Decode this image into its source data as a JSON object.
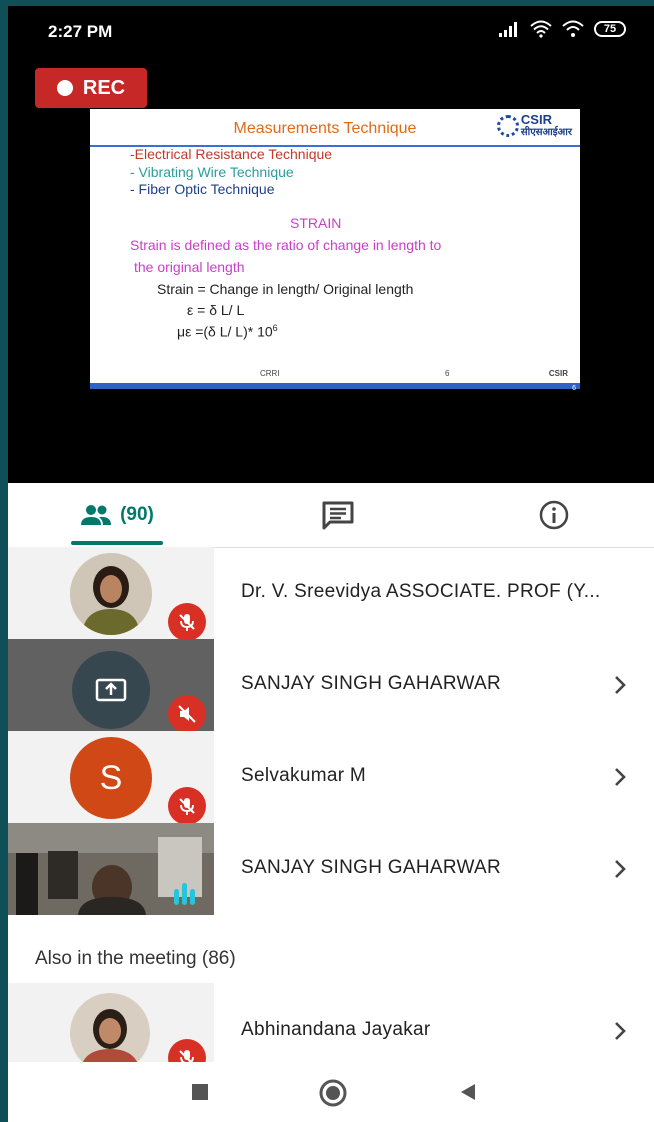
{
  "status_bar": {
    "time": "2:27 PM",
    "battery": "75"
  },
  "recording": {
    "label": "REC"
  },
  "slide": {
    "title": "Measurements Technique",
    "logo_text_top": "CSIR",
    "logo_text_bottom": "सीएसआईआर",
    "lines": [
      "-Electrical Resistance Technique",
      "- Vibrating Wire Technique",
      "- Fiber Optic Technique",
      "STRAIN",
      "Strain is defined as the ratio of change in length to",
      "the original length",
      "Strain = Change in length/ Original length",
      "ε = δ L/ L",
      "με =(δ L/ L)* 10",
      "6"
    ],
    "footer_left": "CRRI",
    "footer_mid": "6",
    "footer_right": "CSIR",
    "footer_page": "6"
  },
  "tabs": {
    "people_count": "(90)"
  },
  "participants": [
    {
      "name": "Dr. V. Sreevidya ASSOCIATE. PROF (Y..."
    },
    {
      "name": "SANJAY SINGH GAHARWAR"
    },
    {
      "name": "Selvakumar M",
      "initial": "S"
    },
    {
      "name": "SANJAY SINGH GAHARWAR"
    }
  ],
  "also_in_meeting": {
    "label": "Also in the meeting (86)"
  },
  "others": [
    {
      "name": "Abhinandana Jayakar"
    }
  ],
  "colors": {
    "accent": "#00796b",
    "rec": "#c62828",
    "mute": "#d93025",
    "avatar_s": "#d14817"
  }
}
